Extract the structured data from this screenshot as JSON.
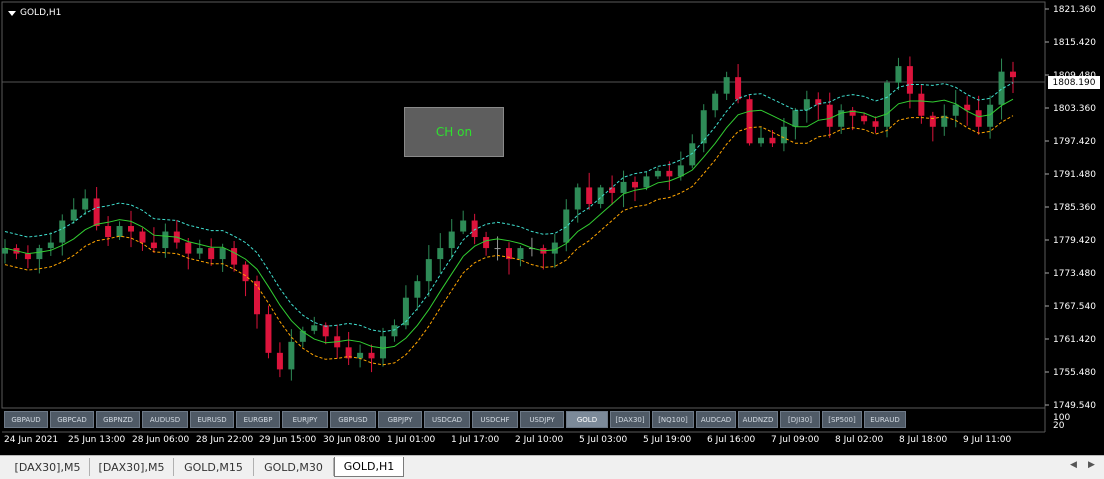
{
  "chart": {
    "title": "GOLD,H1",
    "button_label": "CH on",
    "current_price": "1808.190",
    "price_axis": [
      "1821.360",
      "1815.420",
      "1809.480",
      "1803.360",
      "1797.420",
      "1791.480",
      "1785.360",
      "1779.420",
      "1773.480",
      "1767.540",
      "1761.420",
      "1755.480",
      "1749.540"
    ],
    "indicator_axis": [
      "100",
      "20"
    ],
    "time_axis": [
      "24 Jun 2021",
      "25 Jun 13:00",
      "28 Jun 06:00",
      "28 Jun 22:00",
      "29 Jun 15:00",
      "30 Jun 08:00",
      "1 Jul 01:00",
      "1 Jul 17:00",
      "2 Jul 10:00",
      "5 Jul 03:00",
      "5 Jul 19:00",
      "6 Jul 16:00",
      "7 Jul 09:00",
      "8 Jul 02:00",
      "8 Jul 18:00",
      "9 Jul 11:00"
    ],
    "colors": {
      "bull": "#2e8b57",
      "bear": "#dc143c",
      "neutral": "#9a9a9a",
      "ma": "#32cd32",
      "upper": "#40e0d0",
      "lower": "#ffa500"
    },
    "closes": [
      1778,
      1777,
      1776,
      1778,
      1779,
      1783,
      1785,
      1787,
      1782,
      1780,
      1782,
      1781,
      1779,
      1778,
      1781,
      1779,
      1777,
      1778,
      1776,
      1778,
      1775,
      1772,
      1766,
      1759,
      1756,
      1761,
      1763,
      1764,
      1762,
      1760,
      1758,
      1759,
      1758,
      1762,
      1764,
      1769,
      1772,
      1776,
      1778,
      1781,
      1783,
      1780,
      1778,
      1778,
      1776,
      1778,
      1778,
      1777,
      1779,
      1785,
      1789,
      1786,
      1789,
      1788,
      1790,
      1789,
      1791,
      1792,
      1791,
      1793,
      1797,
      1803,
      1806,
      1809,
      1805,
      1797,
      1798,
      1797,
      1800,
      1803,
      1805,
      1804,
      1800,
      1803,
      1802,
      1801,
      1800,
      1808,
      1811,
      1806,
      1802,
      1800,
      1802,
      1804,
      1803,
      1800,
      1804,
      1810,
      1809
    ]
  },
  "symbols": [
    {
      "label": "GBPAUD"
    },
    {
      "label": "GBPCAD"
    },
    {
      "label": "GBPNZD"
    },
    {
      "label": "AUDUSD"
    },
    {
      "label": "EURUSD"
    },
    {
      "label": "EURGBP"
    },
    {
      "label": "EURJPY"
    },
    {
      "label": "GBPUSD"
    },
    {
      "label": "GBPJPY"
    },
    {
      "label": "USDCAD"
    },
    {
      "label": "USDCHF"
    },
    {
      "label": "USDJPY"
    },
    {
      "label": "GOLD",
      "active": true
    },
    {
      "label": "[DAX30]"
    },
    {
      "label": "[NQ100]"
    },
    {
      "label": "AUDCAD"
    },
    {
      "label": "AUDNZD"
    },
    {
      "label": "[DJI30]"
    },
    {
      "label": "[SP500]"
    },
    {
      "label": "EURAUD"
    }
  ],
  "tabs": [
    {
      "label": "[DAX30],M5"
    },
    {
      "label": "[DAX30],M5"
    },
    {
      "label": "GOLD,M15"
    },
    {
      "label": "GOLD,M30"
    },
    {
      "label": "GOLD,H1",
      "active": true
    }
  ]
}
